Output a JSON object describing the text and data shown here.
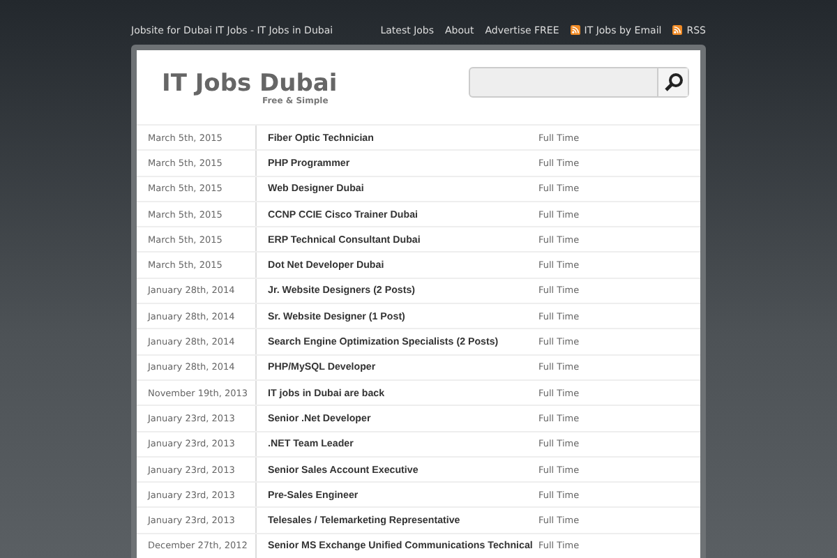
{
  "site_tagline": "Jobsite for Dubai IT Jobs - IT Jobs in Dubai",
  "nav": [
    {
      "label": "Latest Jobs",
      "kind": "link"
    },
    {
      "label": "About",
      "kind": "link"
    },
    {
      "label": "Advertise FREE",
      "kind": "link"
    },
    {
      "label": "IT Jobs by Email",
      "kind": "feed"
    },
    {
      "label": "RSS",
      "kind": "feed"
    }
  ],
  "logo": {
    "title": "IT Jobs Dubai",
    "subtitle": "Free & Simple"
  },
  "jobs": [
    {
      "date": "March 5th, 2015",
      "title": "Fiber Optic Technician",
      "type": "Full Time"
    },
    {
      "date": "March 5th, 2015",
      "title": "PHP Programmer",
      "type": "Full Time"
    },
    {
      "date": "March 5th, 2015",
      "title": "Web Designer Dubai",
      "type": "Full Time"
    },
    {
      "date": "March 5th, 2015",
      "title": "CCNP CCIE Cisco Trainer Dubai",
      "type": "Full Time"
    },
    {
      "date": "March 5th, 2015",
      "title": "ERP Technical Consultant Dubai",
      "type": "Full Time"
    },
    {
      "date": "March 5th, 2015",
      "title": "Dot Net Developer Dubai",
      "type": "Full Time"
    },
    {
      "date": "January 28th, 2014",
      "title": "Jr. Website Designers (2 Posts)",
      "type": "Full Time"
    },
    {
      "date": "January 28th, 2014",
      "title": "Sr. Website Designer (1 Post)",
      "type": "Full Time"
    },
    {
      "date": "January 28th, 2014",
      "title": "Search Engine Optimization Specialists (2 Posts)",
      "type": "Full Time"
    },
    {
      "date": "January 28th, 2014",
      "title": "PHP/MySQL Developer",
      "type": "Full Time"
    },
    {
      "date": "November 19th, 2013",
      "title": "IT jobs in Dubai are back",
      "type": "Full Time"
    },
    {
      "date": "January 23rd, 2013",
      "title": "Senior .Net Developer",
      "type": "Full Time"
    },
    {
      "date": "January 23rd, 2013",
      "title": ".NET Team Leader",
      "type": "Full Time"
    },
    {
      "date": "January 23rd, 2013",
      "title": "Senior Sales Account Executive",
      "type": "Full Time"
    },
    {
      "date": "January 23rd, 2013",
      "title": "Pre-Sales Engineer",
      "type": "Full Time"
    },
    {
      "date": "January 23rd, 2013",
      "title": "Telesales / Telemarketing Representative",
      "type": "Full Time"
    },
    {
      "date": "December 27th, 2012",
      "title": "Senior MS Exchange Unified Communications Technical",
      "type": "Full Time"
    }
  ]
}
